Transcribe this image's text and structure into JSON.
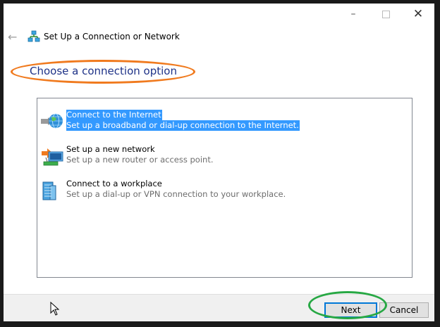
{
  "window": {
    "title": "Set Up a Connection or Network",
    "controls": {
      "minimize_icon": "minimize-icon",
      "maximize_icon": "maximize-icon",
      "close_icon": "close-icon"
    }
  },
  "heading": "Choose a connection option",
  "options": [
    {
      "title": "Connect to the Internet",
      "description": "Set up a broadband or dial-up connection to the Internet.",
      "icon": "globe-icon",
      "selected": true
    },
    {
      "title": "Set up a new network",
      "description": "Set up a new router or access point.",
      "icon": "router-icon",
      "selected": false
    },
    {
      "title": "Connect to a workplace",
      "description": "Set up a dial-up or VPN connection to your workplace.",
      "icon": "workplace-icon",
      "selected": false
    }
  ],
  "buttons": {
    "next": "Next",
    "cancel": "Cancel"
  },
  "colors": {
    "selection": "#3399ff",
    "heading": "#1e3287",
    "annotation_orange": "#f07a1e",
    "annotation_green": "#27a844"
  }
}
